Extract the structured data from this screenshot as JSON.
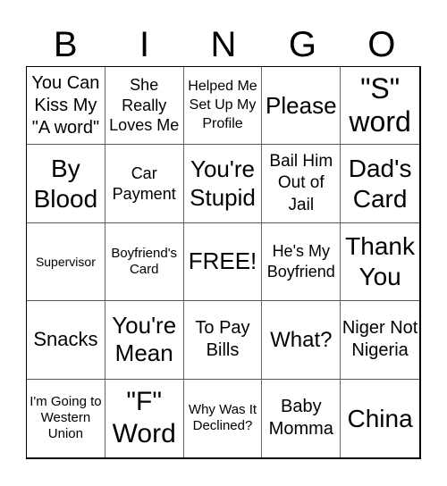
{
  "header": {
    "letters": [
      "B",
      "I",
      "N",
      "G",
      "O"
    ]
  },
  "card": {
    "rows": [
      [
        "You Can Kiss My \"A word\"",
        "She Really Loves Me",
        "Helped Me Set Up My Profile",
        "Please",
        "\"S\" word"
      ],
      [
        "By Blood",
        "Car Payment",
        "You're Stupid",
        "Bail Him Out of Jail",
        "Dad's Card"
      ],
      [
        "Supervisor",
        "Boyfriend's Card",
        "FREE!",
        "He's My Boyfriend",
        "Thank You"
      ],
      [
        "Snacks",
        "You're Mean",
        "To Pay Bills",
        "What?",
        "Niger Not Nigeria"
      ],
      [
        "I'm Going to Western Union",
        "\"F\" Word",
        "Why Was It Declined?",
        "Baby Momma",
        "China"
      ]
    ]
  }
}
